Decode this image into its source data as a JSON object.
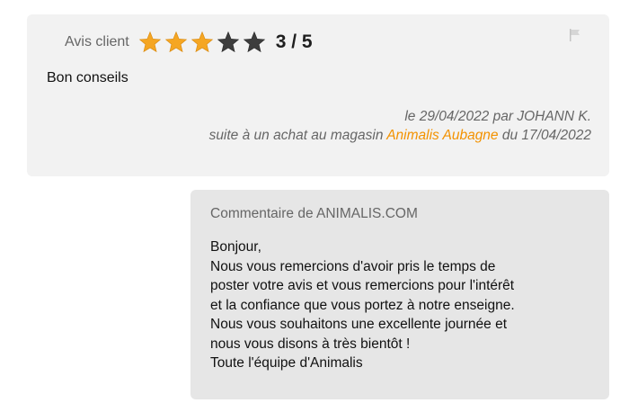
{
  "review": {
    "rating_label": "Avis client",
    "rating": {
      "value": 3,
      "max": 5
    },
    "score_text": "3 / 5",
    "title": "Bon conseils",
    "date_line": "le 29/04/2022 par JOHANN K.",
    "purchase_prefix": "suite à un achat au magasin ",
    "store_name": "Animalis Aubagne",
    "purchase_suffix": " du 17/04/2022",
    "flag_icon": "flag-icon",
    "colors": {
      "star_filled": "#f5a623",
      "star_empty": "#3d3d3d",
      "store_link": "#f39200"
    }
  },
  "reply": {
    "header": "Commentaire de ANIMALIS.COM",
    "lines": [
      "Bonjour,",
      "Nous vous remercions d'avoir pris le temps de",
      "poster votre avis et vous remercions pour l'intérêt",
      "et la confiance que vous portez à notre enseigne.",
      "Nous vous souhaitons une excellente journée et",
      "nous vous disons à très bientôt !",
      "Toute l'équipe d'Animalis"
    ]
  }
}
